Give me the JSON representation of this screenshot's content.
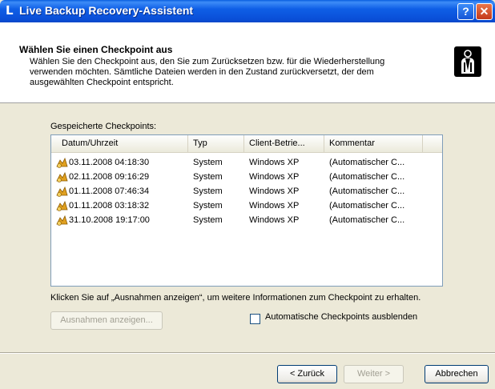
{
  "window": {
    "title": "Live Backup Recovery-Assistent",
    "app_icon_glyph": "L",
    "help_glyph": "?",
    "close_glyph": "✕"
  },
  "header": {
    "title": "Wählen Sie einen Checkpoint aus",
    "description": "Wählen Sie den Checkpoint aus, den Sie zum Zurücksetzen bzw. für die Wiederherstellung verwenden möchten. Sämtliche Dateien werden in den Zustand zurückversetzt, der dem ausgewählten Checkpoint entspricht.",
    "icon": "wizard-person-icon"
  },
  "checkpoints": {
    "caption": "Gespeicherte Checkpoints:",
    "columns": [
      "Datum/Uhrzeit",
      "Typ",
      "Client-Betrie...",
      "Kommentar"
    ],
    "rows": [
      {
        "date": "03.11.2008 04:18:30",
        "type": "System",
        "client": "Windows XP",
        "comment": "(Automatischer C..."
      },
      {
        "date": "02.11.2008 09:16:29",
        "type": "System",
        "client": "Windows XP",
        "comment": "(Automatischer C..."
      },
      {
        "date": "01.11.2008 07:46:34",
        "type": "System",
        "client": "Windows XP",
        "comment": "(Automatischer C..."
      },
      {
        "date": "01.11.2008 03:18:32",
        "type": "System",
        "client": "Windows XP",
        "comment": "(Automatischer C..."
      },
      {
        "date": "31.10.2008 19:17:00",
        "type": "System",
        "client": "Windows XP",
        "comment": "(Automatischer C..."
      }
    ]
  },
  "info_text": "Klicken Sie auf „Ausnahmen anzeigen“, um weitere Informationen zum Checkpoint zu erhalten.",
  "buttons": {
    "ausnahmen": "Ausnahmen anzeigen...",
    "hide_auto": "Automatische Checkpoints ausblenden",
    "back": "< Zurück",
    "next": "Weiter >",
    "cancel": "Abbrechen"
  },
  "colors": {
    "titlebar": "#0a4fd8",
    "dialog_bg": "#ece9d8",
    "list_border": "#7f9db9"
  }
}
